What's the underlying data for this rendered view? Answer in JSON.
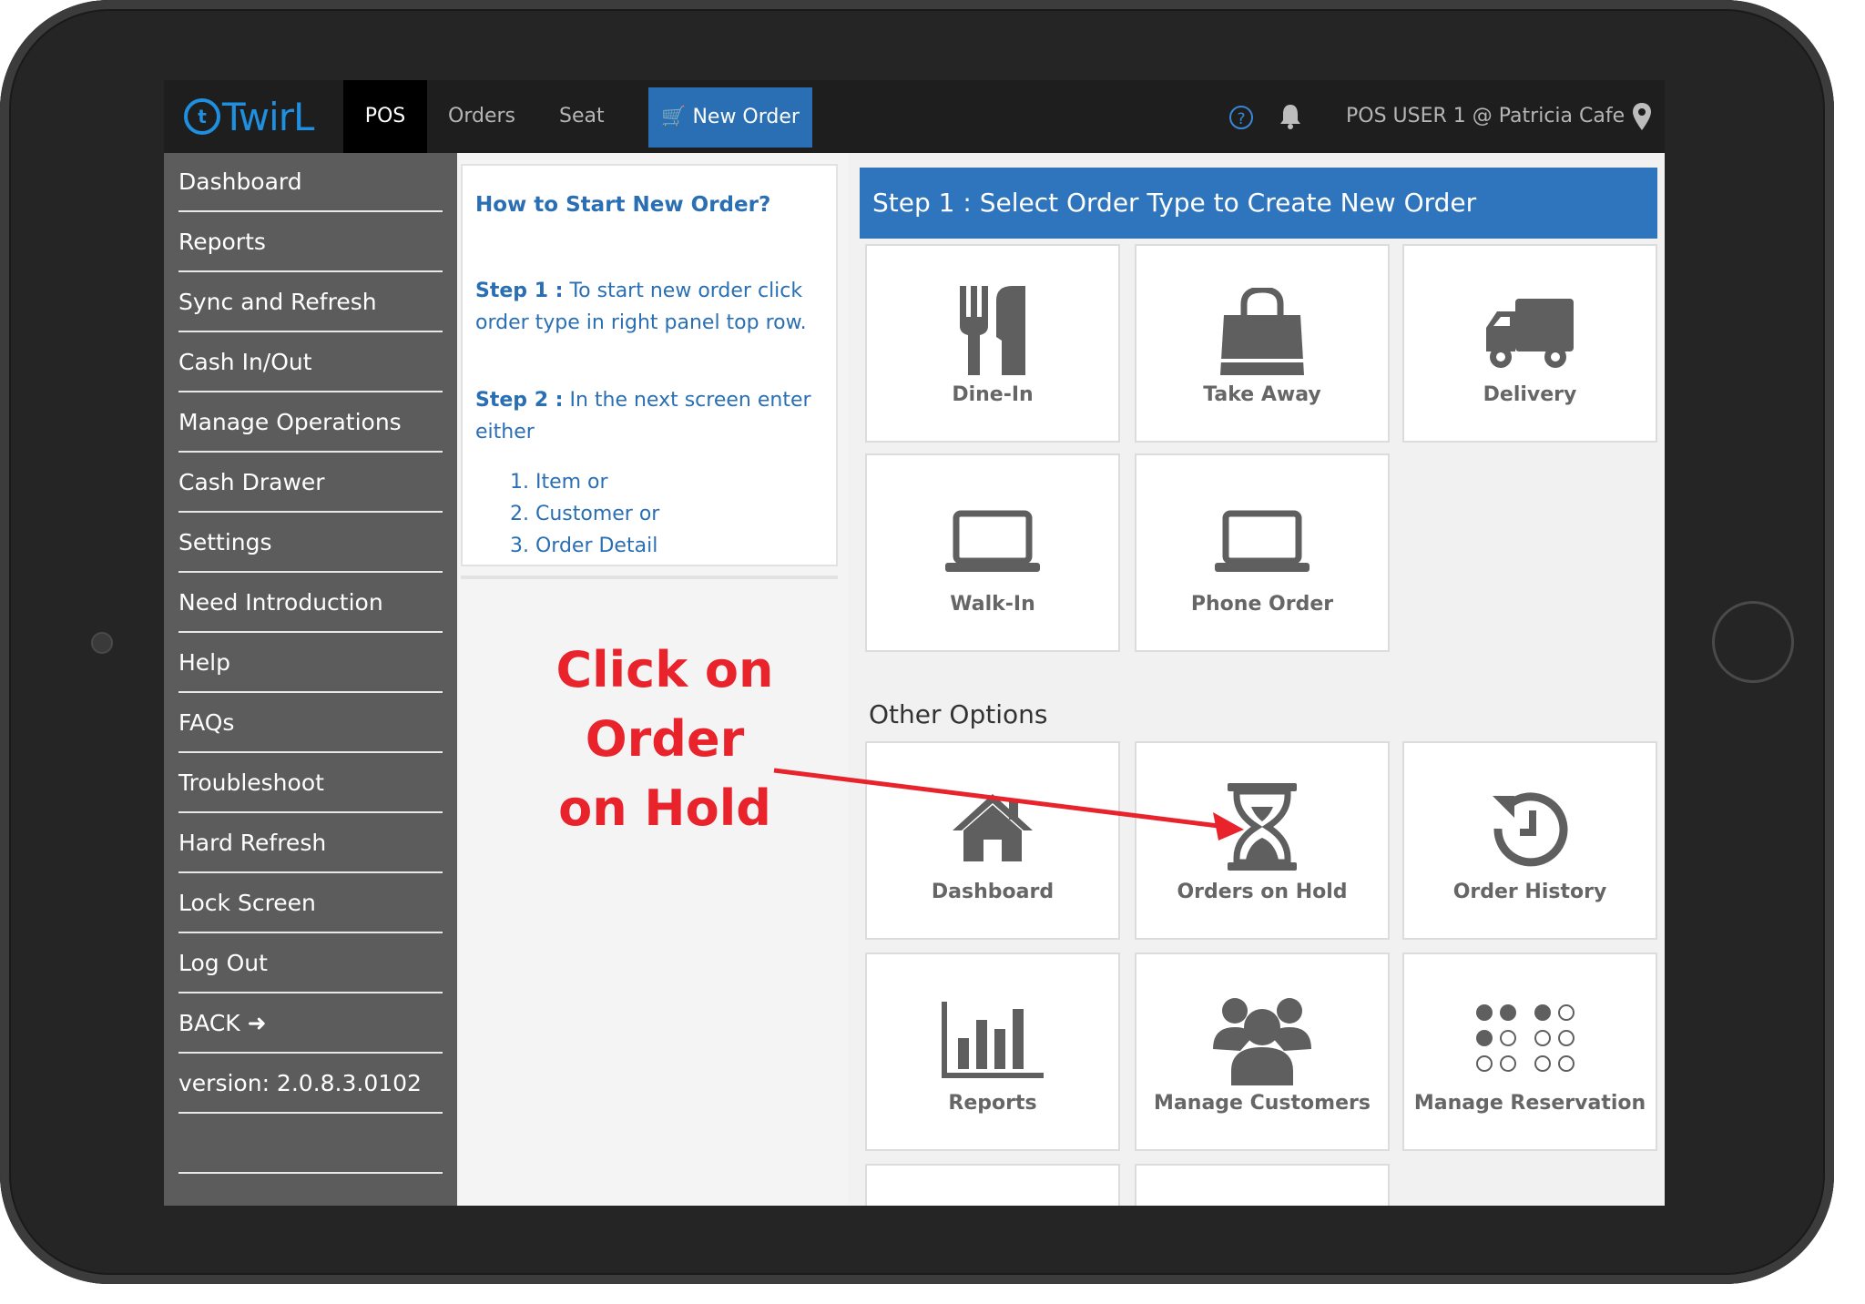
{
  "topbar": {
    "logo_text": "TwirL",
    "tabs": [
      {
        "label": "POS"
      },
      {
        "label": "Orders"
      },
      {
        "label": "Seat"
      }
    ],
    "new_order_label": "New Order",
    "user_label": "POS USER 1 @ Patricia Cafe"
  },
  "sidebar": {
    "items": [
      {
        "label": "Dashboard"
      },
      {
        "label": "Reports"
      },
      {
        "label": "Sync and Refresh"
      },
      {
        "label": "Cash In/Out"
      },
      {
        "label": "Manage Operations"
      },
      {
        "label": "Cash Drawer"
      },
      {
        "label": "Settings"
      },
      {
        "label": "Need Introduction"
      },
      {
        "label": "Help"
      },
      {
        "label": "FAQs"
      },
      {
        "label": "Troubleshoot"
      },
      {
        "label": "Hard Refresh"
      },
      {
        "label": "Lock Screen"
      },
      {
        "label": "Log Out"
      },
      {
        "label": "BACK"
      },
      {
        "label": "version: 2.0.8.3.0102"
      }
    ]
  },
  "help": {
    "title": "How to Start New Order?",
    "step1_label": "Step 1 :",
    "step1_text": " To start new order click order type in right panel top row.",
    "step2_label": "Step 2 :",
    "step2_text": " In the next screen enter either",
    "list": [
      "1. Item or",
      "2. Customer or",
      "3. Order Detail"
    ]
  },
  "main": {
    "step_header": "Step 1 : Select Order Type to Create New Order",
    "order_types": [
      {
        "label": "Dine-In",
        "icon": "dine-in-icon"
      },
      {
        "label": "Take Away",
        "icon": "shopping-bag-icon"
      },
      {
        "label": "Delivery",
        "icon": "truck-icon"
      },
      {
        "label": "Walk-In",
        "icon": "laptop-icon"
      },
      {
        "label": "Phone Order",
        "icon": "laptop-icon"
      }
    ],
    "other_options_label": "Other Options",
    "other_options": [
      {
        "label": "Dashboard",
        "icon": "home-icon"
      },
      {
        "label": "Orders on Hold",
        "icon": "hourglass-icon"
      },
      {
        "label": "Order History",
        "icon": "history-icon"
      },
      {
        "label": "Reports",
        "icon": "bar-chart-icon"
      },
      {
        "label": "Manage Customers",
        "icon": "users-icon"
      },
      {
        "label": "Manage Reservation",
        "icon": "reservation-dots-icon"
      }
    ]
  },
  "annotation": {
    "line1": "Click on Order",
    "line2": "on Hold",
    "color": "#e8232b"
  },
  "colors": {
    "brand_blue": "#2a6fb3",
    "header_blue": "#2e75bd",
    "sidebar_gray": "#5c5c5c",
    "topbar_dark": "#1e1e1e"
  }
}
